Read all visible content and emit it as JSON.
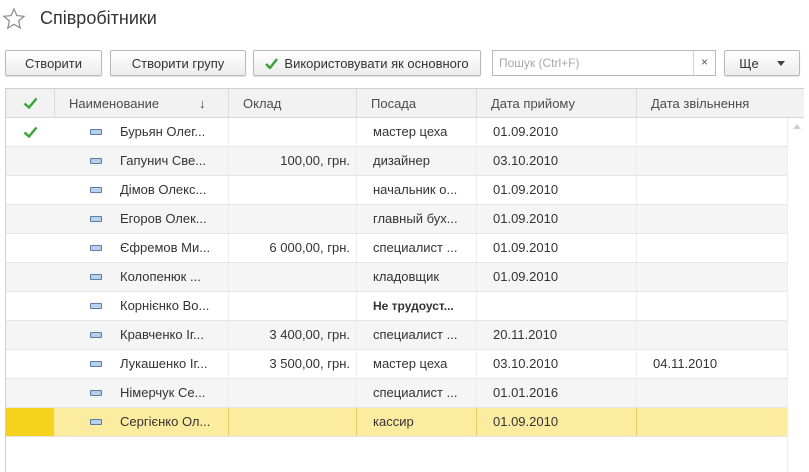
{
  "window": {
    "title": "Співробітники",
    "favorite_icon": "star-icon"
  },
  "toolbar": {
    "create_label": "Створити",
    "create_group_label": "Створити групу",
    "use_as_main_label": "Використовувати як основного",
    "search_placeholder": "Пошук (Ctrl+F)",
    "search_value": "",
    "clear_label": "×",
    "more_label": "Ще"
  },
  "grid": {
    "columns": {
      "mark": "✔",
      "name": "Наименование",
      "sort_indicator": "↓",
      "salary": "Оклад",
      "position": "Посада",
      "hire_date": "Дата прийому",
      "dismissal_date": "Дата звільнення"
    },
    "rows": [
      {
        "name": "Бурьян Олег...",
        "salary": "",
        "position": "мастер цеха",
        "hire_date": "01.09.2010",
        "dismissal_date": "",
        "main": true
      },
      {
        "name": "Гапунич Све...",
        "salary": "100,00, грн.",
        "position": "дизайнер",
        "hire_date": "03.10.2010",
        "dismissal_date": ""
      },
      {
        "name": "Дімов Олекс...",
        "salary": "",
        "position": "начальник о...",
        "hire_date": "01.09.2010",
        "dismissal_date": ""
      },
      {
        "name": "Егоров Олек...",
        "salary": "",
        "position": "главный бух...",
        "hire_date": "01.09.2010",
        "dismissal_date": ""
      },
      {
        "name": "Єфремов Ми...",
        "salary": "6 000,00, грн.",
        "position": "специалист ...",
        "hire_date": "01.09.2010",
        "dismissal_date": ""
      },
      {
        "name": "Колопенюк ...",
        "salary": "",
        "position": "кладовщик",
        "hire_date": "01.09.2010",
        "dismissal_date": ""
      },
      {
        "name": "Корнієнко Во...",
        "salary": "",
        "position": "Не трудоуст...",
        "hire_date": "",
        "dismissal_date": "",
        "bold_position": true
      },
      {
        "name": "Кравченко Іг...",
        "salary": "3 400,00, грн.",
        "position": "специалист ...",
        "hire_date": "20.11.2010",
        "dismissal_date": ""
      },
      {
        "name": "Лукашенко Іг...",
        "salary": "3 500,00, грн.",
        "position": "мастер цеха",
        "hire_date": "03.10.2010",
        "dismissal_date": "04.11.2010"
      },
      {
        "name": "Німерчук Се...",
        "salary": "",
        "position": "специалист ...",
        "hire_date": "01.01.2016",
        "dismissal_date": ""
      },
      {
        "name": "Сергієнко Ол...",
        "salary": "",
        "position": "кассир",
        "hire_date": "01.09.2010",
        "dismissal_date": "",
        "selected": true
      }
    ]
  },
  "colors": {
    "check_green": "#3aa23a",
    "selected_row": "#fbeca0",
    "selected_marker": "#f5d31c"
  }
}
